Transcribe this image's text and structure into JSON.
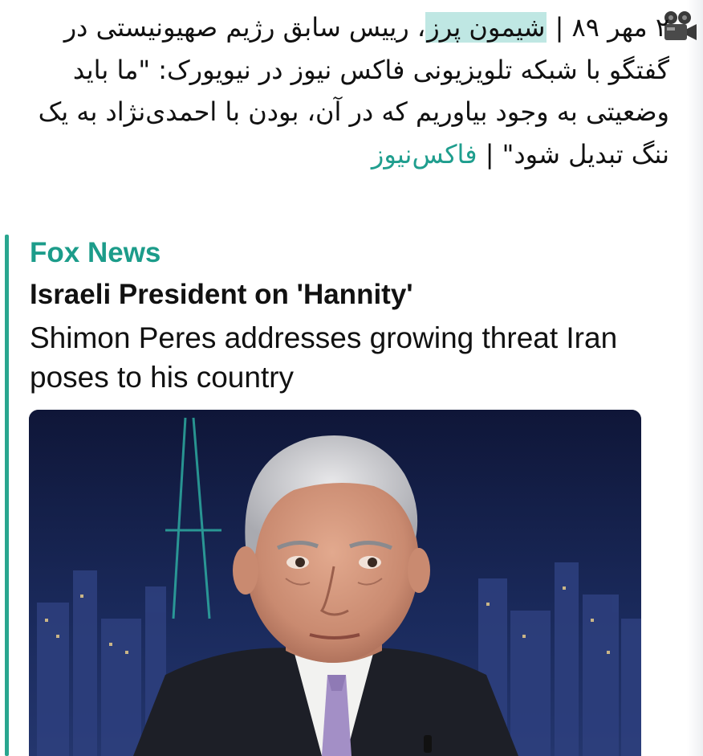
{
  "message": {
    "icon": "movie-camera-icon",
    "date": "۲ مهر ۸۹",
    "separator": "|",
    "highlighted_name": "شیمون پرز",
    "body": "، رییس سابق رژیم صهیونیستی در گفتگو با شبکه تلویزیونی فاکس نیوز در نیویورک:   \"ما باید وضعیتی به وجود بیاوریم که در آن، بودن با احمدی‌نژاد به یک ننگ تبدیل شود\"",
    "closing_separator": "|",
    "source_link": "فاکس‌نیوز"
  },
  "link_preview": {
    "site_name": "Fox News",
    "title": "Israeli President on 'Hannity'",
    "description": "Shimon Peres addresses growing threat Iran poses to his country",
    "image": "news-photo-elderly-man-suit-city-night-backdrop",
    "accent_color": "#29a68f"
  },
  "colors": {
    "highlight": "#bfe7e3",
    "link": "#1f9e8e",
    "site_name": "#1c9c8a"
  }
}
